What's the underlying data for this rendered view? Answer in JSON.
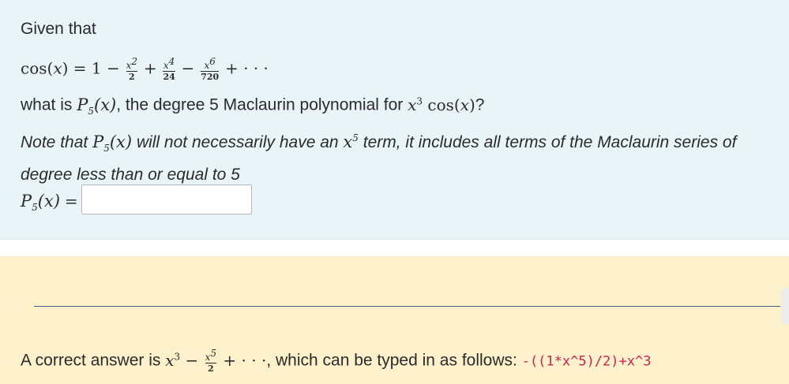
{
  "problem": {
    "intro": "Given that",
    "series": {
      "lhs": "cos(x) = 1 −",
      "t1_num": "x2",
      "t1_den": "2",
      "plus1": "+",
      "t2_num": "x4",
      "t2_den": "24",
      "minus1": "−",
      "t3_num": "x6",
      "t3_den": "720",
      "tail": "+ · · ·"
    },
    "question_prefix": "what is",
    "question_func": "P5(x)",
    "question_middle": ", the degree 5 Maclaurin polynomial for",
    "question_expr": "x3 cos(x)",
    "question_end": "?",
    "note_prefix": "Note that",
    "note_func": "P5(x)",
    "note_middle": "will not necessarily have an",
    "note_power": "x5",
    "note_rest": "term, it includes all terms of the Maclaurin series of degree less than or equal to 5",
    "input_label": "P5(x) =",
    "input_value": ""
  },
  "solution": {
    "prefix": "A correct answer is",
    "answer_math": "x3 − x5/2 + · · ·",
    "middle": ", which can be typed in as follows:",
    "typed": "-((1*x^5)/2)+x^3"
  },
  "colors": {
    "problem_bg": "#e8f4f7",
    "solution_bg": "#fdf1cc",
    "code_color": "#c7254e",
    "divider": "#3d5f86"
  }
}
